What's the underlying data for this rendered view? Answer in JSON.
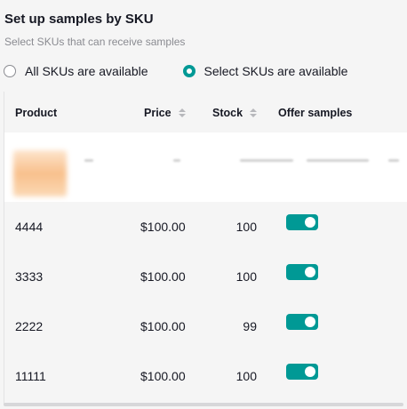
{
  "header": {
    "title": "Set up samples by SKU",
    "subtitle": "Select SKUs that can receive samples"
  },
  "availability": {
    "options": [
      {
        "label": "All SKUs are available",
        "selected": false
      },
      {
        "label": "Select SKUs are available",
        "selected": true
      }
    ]
  },
  "table": {
    "columns": {
      "product": "Product",
      "price": "Price",
      "stock": "Stock",
      "offer": "Offer samples"
    },
    "rows": [
      {
        "product": "4444",
        "price": "$100.00",
        "stock": "100",
        "offer_samples": true
      },
      {
        "product": "3333",
        "price": "$100.00",
        "stock": "100",
        "offer_samples": true
      },
      {
        "product": "2222",
        "price": "$100.00",
        "stock": "99",
        "offer_samples": true
      },
      {
        "product": "11111",
        "price": "$100.00",
        "stock": "100",
        "offer_samples": true
      }
    ]
  },
  "colors": {
    "accent": "#009995",
    "muted_text": "#8a8b91"
  }
}
